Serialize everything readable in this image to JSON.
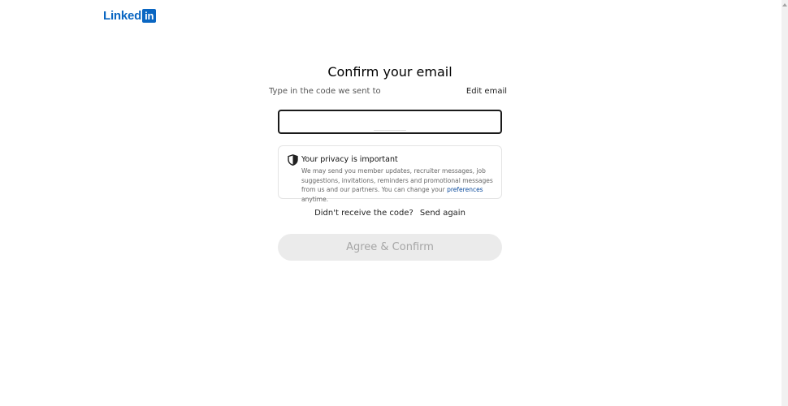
{
  "header": {
    "logo_text": "Linked",
    "logo_box_text": "in"
  },
  "main": {
    "title": "Confirm your email",
    "subtitle": "Type in the code we sent to",
    "edit_email_label": "Edit email",
    "code_input": {
      "value": "",
      "placeholder": "______"
    },
    "privacy": {
      "icon": "shield-icon",
      "title": "Your privacy is important",
      "body_text": "We may send you member updates, recruiter messages, job suggestions, invitations, reminders and promotional messages from us and our partners. You can change your ",
      "link_text": "preferences",
      "body_suffix": " anytime."
    },
    "resend": {
      "question": "Didn't receive the code?",
      "link_label": "Send again"
    },
    "confirm_button_label": "Agree & Confirm"
  },
  "colors": {
    "brand": "#0a66c2",
    "link": "#0a4a9c",
    "disabled_button_bg": "#ebebeb",
    "disabled_button_text": "#a6a6a6"
  }
}
